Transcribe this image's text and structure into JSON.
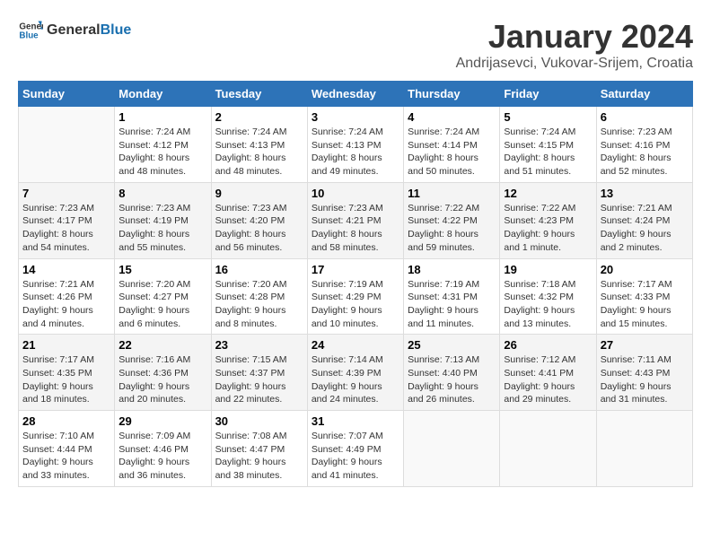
{
  "logo": {
    "text_general": "General",
    "text_blue": "Blue"
  },
  "header": {
    "month": "January 2024",
    "location": "Andrijasevci, Vukovar-Srijem, Croatia"
  },
  "weekdays": [
    "Sunday",
    "Monday",
    "Tuesday",
    "Wednesday",
    "Thursday",
    "Friday",
    "Saturday"
  ],
  "weeks": [
    [
      {
        "day": "",
        "info": ""
      },
      {
        "day": "1",
        "info": "Sunrise: 7:24 AM\nSunset: 4:12 PM\nDaylight: 8 hours\nand 48 minutes."
      },
      {
        "day": "2",
        "info": "Sunrise: 7:24 AM\nSunset: 4:13 PM\nDaylight: 8 hours\nand 48 minutes."
      },
      {
        "day": "3",
        "info": "Sunrise: 7:24 AM\nSunset: 4:13 PM\nDaylight: 8 hours\nand 49 minutes."
      },
      {
        "day": "4",
        "info": "Sunrise: 7:24 AM\nSunset: 4:14 PM\nDaylight: 8 hours\nand 50 minutes."
      },
      {
        "day": "5",
        "info": "Sunrise: 7:24 AM\nSunset: 4:15 PM\nDaylight: 8 hours\nand 51 minutes."
      },
      {
        "day": "6",
        "info": "Sunrise: 7:23 AM\nSunset: 4:16 PM\nDaylight: 8 hours\nand 52 minutes."
      }
    ],
    [
      {
        "day": "7",
        "info": "Sunrise: 7:23 AM\nSunset: 4:17 PM\nDaylight: 8 hours\nand 54 minutes."
      },
      {
        "day": "8",
        "info": "Sunrise: 7:23 AM\nSunset: 4:19 PM\nDaylight: 8 hours\nand 55 minutes."
      },
      {
        "day": "9",
        "info": "Sunrise: 7:23 AM\nSunset: 4:20 PM\nDaylight: 8 hours\nand 56 minutes."
      },
      {
        "day": "10",
        "info": "Sunrise: 7:23 AM\nSunset: 4:21 PM\nDaylight: 8 hours\nand 58 minutes."
      },
      {
        "day": "11",
        "info": "Sunrise: 7:22 AM\nSunset: 4:22 PM\nDaylight: 8 hours\nand 59 minutes."
      },
      {
        "day": "12",
        "info": "Sunrise: 7:22 AM\nSunset: 4:23 PM\nDaylight: 9 hours\nand 1 minute."
      },
      {
        "day": "13",
        "info": "Sunrise: 7:21 AM\nSunset: 4:24 PM\nDaylight: 9 hours\nand 2 minutes."
      }
    ],
    [
      {
        "day": "14",
        "info": "Sunrise: 7:21 AM\nSunset: 4:26 PM\nDaylight: 9 hours\nand 4 minutes."
      },
      {
        "day": "15",
        "info": "Sunrise: 7:20 AM\nSunset: 4:27 PM\nDaylight: 9 hours\nand 6 minutes."
      },
      {
        "day": "16",
        "info": "Sunrise: 7:20 AM\nSunset: 4:28 PM\nDaylight: 9 hours\nand 8 minutes."
      },
      {
        "day": "17",
        "info": "Sunrise: 7:19 AM\nSunset: 4:29 PM\nDaylight: 9 hours\nand 10 minutes."
      },
      {
        "day": "18",
        "info": "Sunrise: 7:19 AM\nSunset: 4:31 PM\nDaylight: 9 hours\nand 11 minutes."
      },
      {
        "day": "19",
        "info": "Sunrise: 7:18 AM\nSunset: 4:32 PM\nDaylight: 9 hours\nand 13 minutes."
      },
      {
        "day": "20",
        "info": "Sunrise: 7:17 AM\nSunset: 4:33 PM\nDaylight: 9 hours\nand 15 minutes."
      }
    ],
    [
      {
        "day": "21",
        "info": "Sunrise: 7:17 AM\nSunset: 4:35 PM\nDaylight: 9 hours\nand 18 minutes."
      },
      {
        "day": "22",
        "info": "Sunrise: 7:16 AM\nSunset: 4:36 PM\nDaylight: 9 hours\nand 20 minutes."
      },
      {
        "day": "23",
        "info": "Sunrise: 7:15 AM\nSunset: 4:37 PM\nDaylight: 9 hours\nand 22 minutes."
      },
      {
        "day": "24",
        "info": "Sunrise: 7:14 AM\nSunset: 4:39 PM\nDaylight: 9 hours\nand 24 minutes."
      },
      {
        "day": "25",
        "info": "Sunrise: 7:13 AM\nSunset: 4:40 PM\nDaylight: 9 hours\nand 26 minutes."
      },
      {
        "day": "26",
        "info": "Sunrise: 7:12 AM\nSunset: 4:41 PM\nDaylight: 9 hours\nand 29 minutes."
      },
      {
        "day": "27",
        "info": "Sunrise: 7:11 AM\nSunset: 4:43 PM\nDaylight: 9 hours\nand 31 minutes."
      }
    ],
    [
      {
        "day": "28",
        "info": "Sunrise: 7:10 AM\nSunset: 4:44 PM\nDaylight: 9 hours\nand 33 minutes."
      },
      {
        "day": "29",
        "info": "Sunrise: 7:09 AM\nSunset: 4:46 PM\nDaylight: 9 hours\nand 36 minutes."
      },
      {
        "day": "30",
        "info": "Sunrise: 7:08 AM\nSunset: 4:47 PM\nDaylight: 9 hours\nand 38 minutes."
      },
      {
        "day": "31",
        "info": "Sunrise: 7:07 AM\nSunset: 4:49 PM\nDaylight: 9 hours\nand 41 minutes."
      },
      {
        "day": "",
        "info": ""
      },
      {
        "day": "",
        "info": ""
      },
      {
        "day": "",
        "info": ""
      }
    ]
  ]
}
